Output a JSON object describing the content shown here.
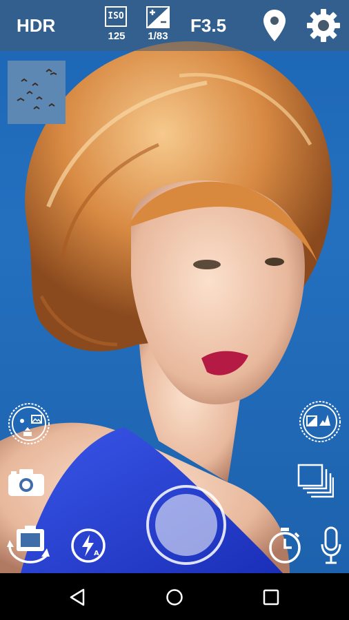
{
  "topbar": {
    "hdr_label": "HDR",
    "iso_label": "ISO",
    "iso_value": "125",
    "exposure_value": "1/83",
    "aperture_label": "F3.5",
    "location_icon": "location-pin-icon",
    "settings_icon": "gear-icon"
  },
  "controls": {
    "left_dial_icon": "scene-modes-dial-icon",
    "right_dial_icon": "exposure-histogram-dial-icon",
    "photo_mode_icon": "camera-icon",
    "burst_icon": "stacked-frames-icon",
    "switch_camera_icon": "switch-camera-icon",
    "flash_icon": "flash-auto-icon",
    "timer_icon": "timer-icon",
    "voice_icon": "microphone-icon",
    "shutter": "shutter-button"
  },
  "navbar": {
    "back_icon": "back-triangle-icon",
    "home_icon": "home-circle-icon",
    "recents_icon": "recents-square-icon"
  },
  "colors": {
    "sky": "#1f6ab8",
    "topbar": "#465a6e",
    "accent": "#ffffff"
  }
}
